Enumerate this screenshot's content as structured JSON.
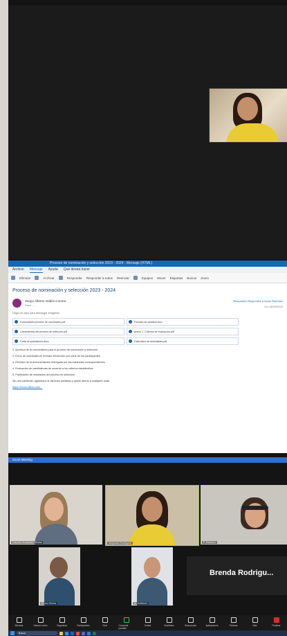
{
  "outlook": {
    "title_bar": "Proceso de nominación y selección 2023 - 2024 - Mensaje (HTML)",
    "menu": [
      "Archivo",
      "Mensaje",
      "Ayuda",
      "Qué desea hacer"
    ],
    "ribbon": [
      "Eliminar",
      "Archivar",
      "Responder",
      "Responder a todos",
      "Reenviar",
      "Equipos",
      "Mover",
      "Etiquetas",
      "Buscar",
      "Zoom"
    ],
    "subject": "Proceso de nominación y selección 2023 - 2024",
    "sender_name": "Sergio Alberto Valdés Corona",
    "sender_to": "Para: ...",
    "actions": "Responder  Responder a todos  Reenviar",
    "date": "lun 18/09/2023",
    "hint": "Haga clic aquí para descargar imágenes.",
    "attachments": [
      "Convocatoria proceso de nominación.pdf",
      "Formato de solicitud.docx",
      "Lineamientos del proceso de selección.pdf",
      "Anexo 1. Criterios de evaluación.pdf",
      "Carta de postulación.docx",
      "Calendario de actividades.pdf"
    ],
    "body_items": [
      "1. Apertura de la convocatoria para el proceso de nominación y selección.",
      "2. Envío de solicitudes en formato electrónico por parte de los participantes.",
      "3. Revisión de la documentación entregada por las instancias correspondientes.",
      "4. Evaluación de candidaturas de acuerdo a los criterios establecidos.",
      "5. Publicación de resultados del proceso de selección."
    ],
    "closing": "Sin otro particular, agradezco la atención prestada y quedo atento a cualquier duda.",
    "link": "https://forms.office.com/..."
  },
  "zoom": {
    "title": "Zoom Meeting",
    "tiles": [
      {
        "name": "Claudia Hernández Rivera"
      },
      {
        "name": "Alejandra Rodríguez"
      },
      {
        "name": "P. Martínez"
      },
      {
        "name": "Bruno Olvera"
      },
      {
        "name": "A. Gutiérrez"
      }
    ],
    "brenda_name": "Brenda Rodrigu...",
    "toolbar": [
      "Silenciar",
      "Detener vídeo",
      "Seguridad",
      "Participantes",
      "Chat",
      "Compartir pantalla",
      "Grabar",
      "Subtítulos",
      "Reacciones",
      "Aplicaciones",
      "Pizarras",
      "Más",
      "Finalizar"
    ],
    "taskbar_search": "Buscar"
  }
}
